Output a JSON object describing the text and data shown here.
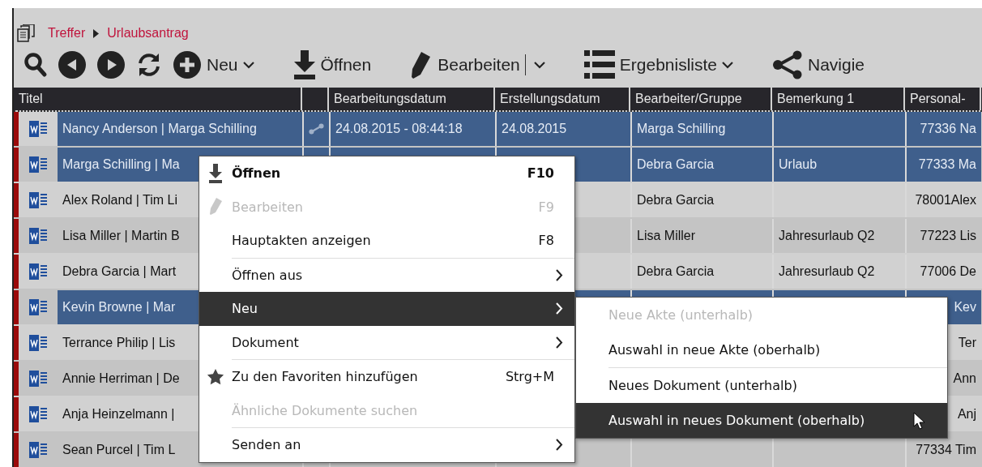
{
  "breadcrumb": [
    {
      "label": "Treffer"
    },
    {
      "label": "Urlaubsantrag"
    }
  ],
  "toolbar": [
    {
      "kind": "search"
    },
    {
      "kind": "back"
    },
    {
      "kind": "forward"
    },
    {
      "kind": "refresh"
    },
    {
      "kind": "plus",
      "label": "Neu",
      "dropdown": true,
      "split": false
    },
    {
      "kind": "download",
      "label": "Öffnen",
      "dropdown": false,
      "split": false
    },
    {
      "kind": "pencil",
      "label": "Bearbeiten",
      "dropdown": true,
      "split": true
    },
    {
      "kind": "list",
      "label": "Ergebnisliste",
      "dropdown": true,
      "split": false
    },
    {
      "kind": "share",
      "label": "Navigie",
      "dropdown": false,
      "split": false
    }
  ],
  "table": {
    "columns": [
      {
        "label": "Titel"
      },
      {},
      {
        "label": "Bearbeitungsdatum"
      },
      {
        "label": "Erstellungsdatum"
      },
      {
        "label": "Bearbeiter/Gruppe"
      },
      {
        "label": "Bemerkung 1"
      },
      {
        "label": "Personal-"
      }
    ],
    "rows": [
      {
        "title": "Nancy Anderson | Marga Schilling",
        "selected": true,
        "focused": true,
        "linked": true,
        "edited": "24.08.2015 - 08:44:18",
        "created": "24.08.2015",
        "editor": "Marga Schilling",
        "personal": "77336 Na"
      },
      {
        "title": "Marga Schilling | Ma",
        "selected": true,
        "focused": false,
        "editor": "Debra Garcia",
        "remark": "Urlaub",
        "personal": "77333 Ma"
      },
      {
        "title": "Alex Roland | Tim Li",
        "selected": false,
        "focused": false,
        "editor": "Debra Garcia",
        "personal": "78001Alex"
      },
      {
        "title": "Lisa Miller | Martin B",
        "selected": false,
        "focused": false,
        "editor": "Lisa Miller",
        "remark": "Jahresurlaub Q2",
        "personal": "77223 Lis"
      },
      {
        "title": "Debra Garcia | Mart",
        "selected": false,
        "focused": false,
        "editor": "Debra Garcia",
        "remark": "Jahresurlaub Q2",
        "personal": "77006 De"
      },
      {
        "title": "Kevin Browne | Mar",
        "selected": true,
        "focused": false,
        "personal": "Kev"
      },
      {
        "title": "Terrance Philip | Lis",
        "selected": false,
        "focused": false,
        "personal": "Ter"
      },
      {
        "title": "Annie Herriman | De",
        "selected": false,
        "focused": false,
        "personal": "Ann"
      },
      {
        "title": "Anja Heinzelmann |",
        "selected": false,
        "focused": false,
        "personal": "Anj"
      },
      {
        "title": "Sean Purcel | Tim L",
        "selected": false,
        "focused": false,
        "personal": "77334 Tim"
      }
    ]
  },
  "context_menu": {
    "groups": [
      [
        {
          "label": "Öffnen",
          "shortcut": "F10",
          "kind": "open",
          "default": true,
          "disabled": false,
          "submenu": false,
          "selected": false
        },
        {
          "label": "Bearbeiten",
          "shortcut": "F9",
          "kind": "edit",
          "default": false,
          "disabled": true,
          "submenu": false,
          "selected": false
        },
        {
          "label": "Hauptakten anzeigen",
          "shortcut": "F8",
          "default": false,
          "disabled": false,
          "submenu": false,
          "selected": false
        }
      ],
      [
        {
          "label": "Öffnen aus",
          "default": false,
          "disabled": false,
          "submenu": true,
          "selected": false
        },
        {
          "label": "Neu",
          "default": false,
          "disabled": false,
          "submenu": true,
          "selected": true
        },
        {
          "label": "Dokument",
          "default": false,
          "disabled": false,
          "submenu": true,
          "selected": false
        }
      ],
      [
        {
          "label": "Zu den Favoriten hinzufügen",
          "shortcut": "Strg+M",
          "kind": "favorite",
          "default": false,
          "disabled": false,
          "submenu": false,
          "selected": false
        },
        {
          "label": "Ähnliche Dokumente suchen",
          "default": false,
          "disabled": true,
          "submenu": false,
          "selected": false
        }
      ],
      [
        {
          "label": "Senden an",
          "default": false,
          "disabled": false,
          "submenu": true,
          "selected": false
        }
      ]
    ]
  },
  "submenu": {
    "groups": [
      [
        {
          "label": "Neue Akte (unterhalb)",
          "disabled": true,
          "selected": false
        },
        {
          "label": "Auswahl in neue Akte (oberhalb)",
          "disabled": false,
          "selected": false
        }
      ],
      [
        {
          "label": "Neues Dokument (unterhalb)",
          "disabled": false,
          "selected": false
        },
        {
          "label": "Auswahl in neues Dokument (oberhalb)",
          "disabled": false,
          "selected": true
        }
      ]
    ]
  }
}
